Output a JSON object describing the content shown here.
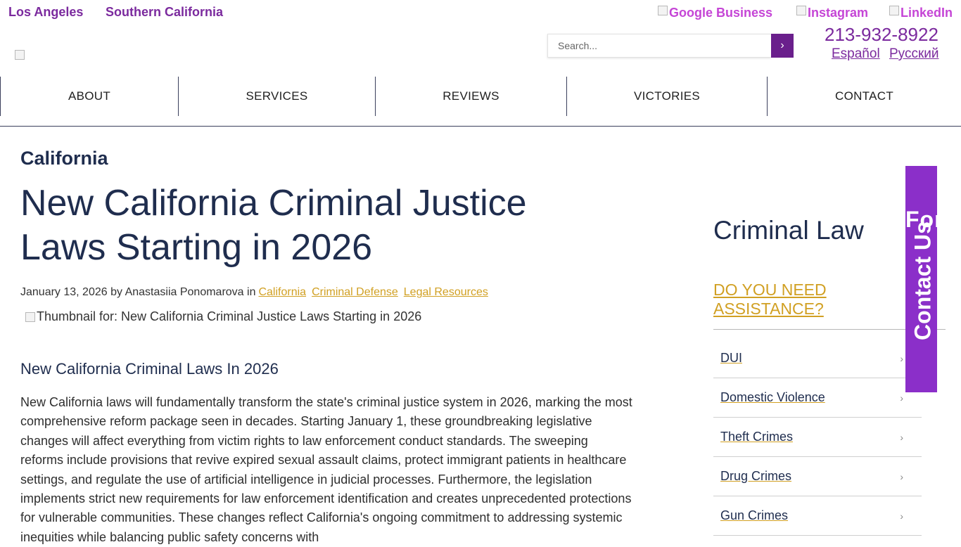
{
  "top_links": {
    "los_angeles": "Los Angeles",
    "southern_california": "Southern California"
  },
  "social": {
    "google": "Google Business",
    "instagram": "Instagram",
    "linkedin": "LinkedIn"
  },
  "phone": "213-932-8922",
  "languages": {
    "spanish": "Español",
    "russian": "Русский"
  },
  "search": {
    "placeholder": "Search...",
    "button": "›"
  },
  "nav": [
    "ABOUT",
    "SERVICES",
    "REVIEWS",
    "VICTORIES",
    "CONTACT"
  ],
  "article": {
    "category": "California",
    "title": "New California Criminal Justice Laws Starting in 2026",
    "date": "January 13, 2026",
    "by": "by",
    "author": "Anastasiia Ponomarova",
    "in": "in",
    "tags": [
      "California",
      "Criminal Defense",
      "Legal Resources"
    ],
    "thumbnail_alt": "Thumbnail for: New California Criminal Justice Laws Starting in 2026",
    "subheading": "New California Criminal Laws In 2026",
    "paragraph": "New California laws will fundamentally transform the state's criminal justice system in 2026, marking the most comprehensive reform package seen in decades. Starting January 1, these groundbreaking legislative changes will affect everything from victim rights to law enforcement conduct standards. The sweeping reforms include provisions that revive expired sexual assault claims, protect immigrant patients in healthcare settings, and regulate the use of artificial intelligence in judicial processes. Furthermore, the legislation implements strict new requirements for law enforcement identification and creates unprecedented protections for vulnerable communities. These changes reflect California's ongoing commitment to addressing systemic inequities while balancing public safety concerns with"
  },
  "sidebar": {
    "title": "Criminal Law",
    "help": "DO YOU NEED ASSISTANCE?",
    "items": [
      "DUI",
      "Domestic Violence",
      "Theft Crimes",
      "Drug Crimes",
      "Gun Crimes"
    ],
    "chevron": "›"
  },
  "contact_tab": {
    "for": "For",
    "label": "Contact Us"
  }
}
